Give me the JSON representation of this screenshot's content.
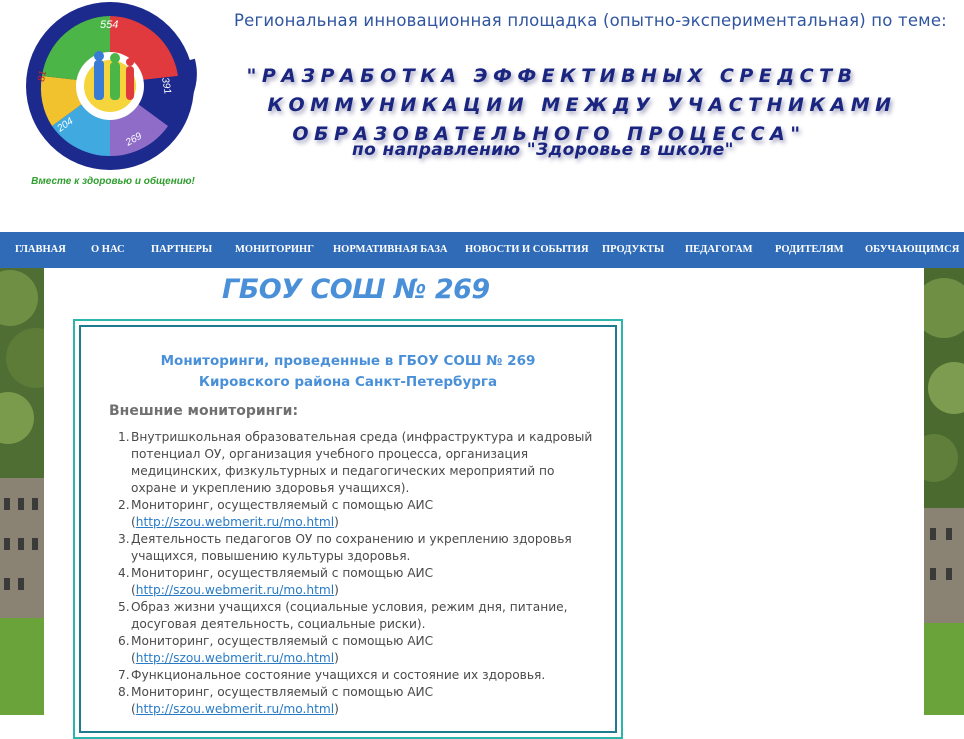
{
  "logo": {
    "segments": [
      "554",
      "391",
      "269",
      "204",
      "81"
    ],
    "slogan": "Вместе к здоровью и общению!"
  },
  "header": {
    "topline": "Региональная инновационная площадка  (опытно-экспериментальная) по теме:",
    "topic_lines": [
      "\"РАЗРАБОТКА ЭФФЕКТИВНЫХ СРЕДСТВ",
      "КОММУНИКАЦИИ МЕЖДУ УЧАСТНИКАМИ",
      "ОБРАЗОВАТЕЛЬНОГО  ПРОЦЕССА\""
    ],
    "direction": "по направлению \"Здоровье в школе\""
  },
  "nav": {
    "items": [
      "ГЛАВНАЯ",
      "О НАС",
      "ПАРТНЕРЫ",
      "МОНИТОРИНГ",
      "НОРМАТИВНАЯ БАЗА",
      "НОВОСТИ И СОБЫТИЯ",
      "ПРОДУКТЫ",
      "ПЕДАГОГАМ",
      "РОДИТЕЛЯМ",
      "ОБУЧАЮЩИМСЯ"
    ]
  },
  "main": {
    "school_title": "ГБОУ СОШ № 269",
    "heading_line1": "Мониторинги, проведенные в ГБОУ СОШ № 269",
    "heading_line2": "Кировского района Санкт-Петербурга",
    "external_heading": "Внешние мониторинги:",
    "items": [
      {
        "num": "1.",
        "text": "Внутришкольная образовательная среда (инфраструктура и кадровый потенциал ОУ, организация учебного процесса, организация медицинских, физкультурных и педагогических мероприятий по охране и укреплению здоровья учащихся)."
      },
      {
        "num": "2.",
        "text": "Мониторинг, осуществляемый с помощью АИС",
        "link": "http://szou.webmerit.ru/mo.html"
      },
      {
        "num": "3.",
        "text": "Деятельность педагогов ОУ по сохранению и укреплению здоровья учащихся, повышению культуры здоровья."
      },
      {
        "num": "4.",
        "text": "Мониторинг, осуществляемый с помощью АИС",
        "link": "http://szou.webmerit.ru/mo.html"
      },
      {
        "num": "5.",
        "text": "Образ жизни учащихся (социальные условия, режим дня, питание, досуговая деятельность, социальные риски)."
      },
      {
        "num": "6.",
        "text": "Мониторинг, осуществляемый с помощью АИС",
        "link": "http://szou.webmerit.ru/mo.html"
      },
      {
        "num": "7.",
        "text": "Функциональное состояние учащихся и состояние их здоровья."
      },
      {
        "num": "8.",
        "text": "Мониторинг, осуществляемый с помощью АИС",
        "link": "http://szou.webmerit.ru/mo.html"
      }
    ]
  },
  "colors": {
    "nav_bg": "#2f6bb7",
    "heading_blue": "#4a90d9",
    "topic_navy": "#1a2580",
    "box_border": "#2cb5ad",
    "link": "#2a7bc6"
  }
}
